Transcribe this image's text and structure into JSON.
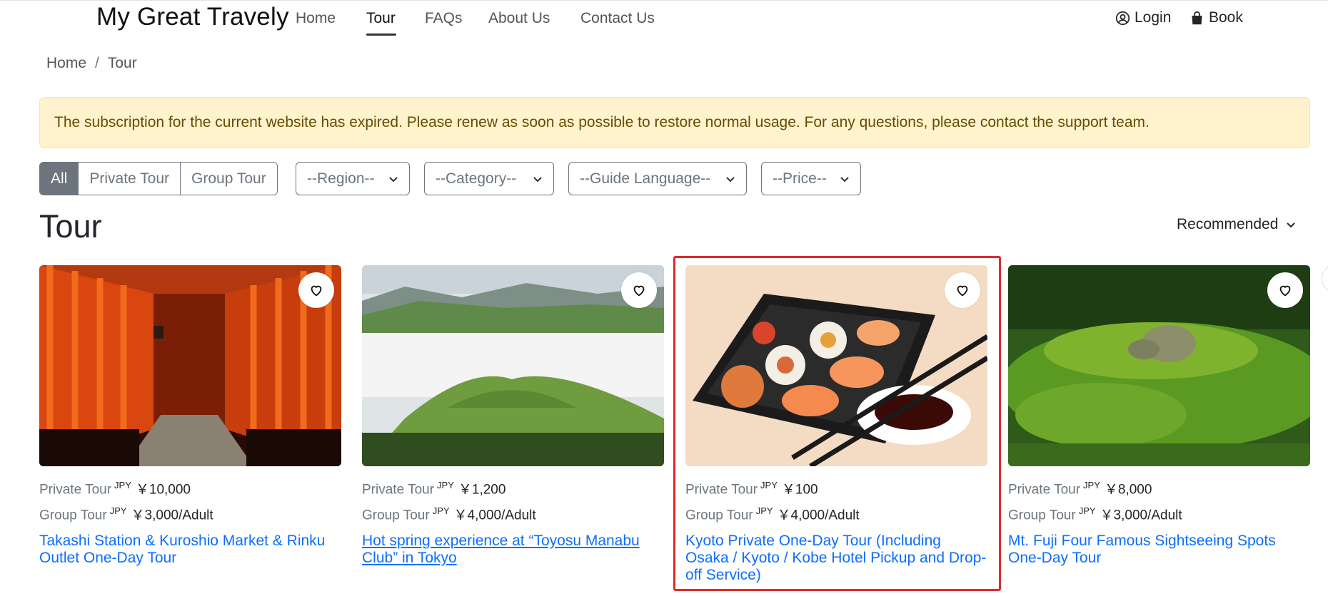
{
  "brand": "My Great Travely",
  "nav": {
    "items": [
      {
        "label": "Home"
      },
      {
        "label": "Tour"
      },
      {
        "label": "FAQs"
      },
      {
        "label": "About Us"
      },
      {
        "label": "Contact Us"
      }
    ],
    "active": "Tour",
    "login_label": "Login",
    "book_label": "Book",
    "login_icon": "person-circle-icon",
    "book_icon": "shopping-bag-icon"
  },
  "breadcrumb": {
    "items": [
      "Home",
      "Tour"
    ],
    "separator": "/"
  },
  "alert": {
    "text": "The subscription for the current website has expired. Please renew as soon as possible to restore normal usage. For any questions, please contact the support team."
  },
  "filters": {
    "type_buttons": [
      "All",
      "Private Tour",
      "Group Tour"
    ],
    "active_type": "All",
    "region": "--Region--",
    "category": "--Category--",
    "guide_language": "--Guide Language--",
    "price": "--Price--"
  },
  "section_title": "Tour",
  "sort_label": "Recommended",
  "cards": [
    {
      "private_label": "Private Tour",
      "private_currency": "JPY",
      "private_price": "￥10,000",
      "group_label": "Group Tour",
      "group_currency": "JPY",
      "group_price": "￥3,000/Adult",
      "title": "Takashi Station & Kuroshio Market & Rinku Outlet One-Day Tour",
      "image": "torii-gates-photo"
    },
    {
      "private_label": "Private Tour",
      "private_currency": "JPY",
      "private_price": "￥1,200",
      "group_label": "Group Tour",
      "group_currency": "JPY",
      "group_price": "￥4,000/Adult",
      "title": "Hot spring experience at “Toyosu Manabu Club” in Tokyo",
      "image": "green-hill-clouds-photo"
    },
    {
      "private_label": "Private Tour",
      "private_currency": "JPY",
      "private_price": "￥100",
      "group_label": "Group Tour",
      "group_currency": "JPY",
      "group_price": "￥4,000/Adult",
      "title": "Kyoto Private One-Day Tour (Including Osaka / Kyoto / Kobe Hotel Pickup and Drop-off Service)",
      "image": "sushi-tray-photo"
    },
    {
      "private_label": "Private Tour",
      "private_currency": "JPY",
      "private_price": "￥8,000",
      "group_label": "Group Tour",
      "group_currency": "JPY",
      "group_price": "￥3,000/Adult",
      "title": "Mt. Fuji Four Famous Sightseeing Spots One-Day Tour",
      "image": "moss-garden-photo"
    }
  ],
  "colors": {
    "link": "#0d6efd",
    "alert_bg": "#fff3cd",
    "alert_text": "#664d03",
    "highlight_border": "#e02a2a",
    "active_filter": "#6c757d"
  }
}
